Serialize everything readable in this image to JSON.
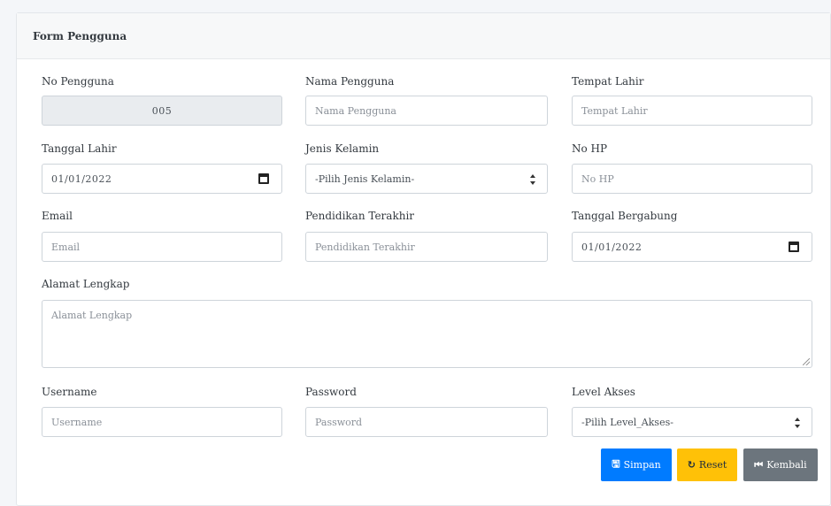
{
  "card": {
    "title": "Form Pengguna"
  },
  "fields": {
    "no_pengguna": {
      "label": "No Pengguna",
      "value": "005"
    },
    "nama_pengguna": {
      "label": "Nama Pengguna",
      "placeholder": "Nama Pengguna"
    },
    "tempat_lahir": {
      "label": "Tempat Lahir",
      "placeholder": "Tempat Lahir"
    },
    "tanggal_lahir": {
      "label": "Tanggal Lahir",
      "value": "01/01/2022"
    },
    "jenis_kelamin": {
      "label": "Jenis Kelamin",
      "selected": "-Pilih Jenis Kelamin-"
    },
    "no_hp": {
      "label": "No HP",
      "placeholder": "No HP"
    },
    "email": {
      "label": "Email",
      "placeholder": "Email"
    },
    "pendidikan_terakhir": {
      "label": "Pendidikan Terakhir",
      "placeholder": "Pendidikan Terakhir"
    },
    "tanggal_bergabung": {
      "label": "Tanggal Bergabung",
      "value": "01/01/2022"
    },
    "alamat_lengkap": {
      "label": "Alamat Lengkap",
      "placeholder": "Alamat Lengkap"
    },
    "username": {
      "label": "Username",
      "placeholder": "Username"
    },
    "password": {
      "label": "Password",
      "placeholder": "Password"
    },
    "level_akses": {
      "label": "Level Akses",
      "selected": "-Pilih Level_Akses-"
    }
  },
  "buttons": {
    "simpan": {
      "label": "Simpan",
      "icon": "floppy-icon",
      "color": "#007bff"
    },
    "reset": {
      "label": "Reset",
      "icon": "refresh-icon",
      "color": "#ffc107"
    },
    "kembali": {
      "label": "Kembali",
      "icon": "back-icon",
      "color": "#6c757d"
    }
  }
}
